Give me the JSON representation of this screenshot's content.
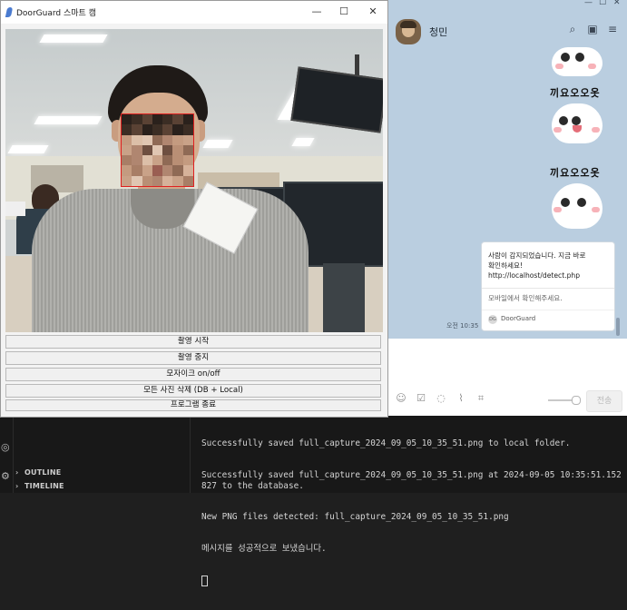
{
  "doorguard": {
    "title": "DoorGuard 스마트 캠",
    "buttons": [
      "촬영 시작",
      "촬영 중지",
      "모자이크 on/off",
      "모든 사진 삭제 (DB + Local)",
      "프로그램 종료"
    ]
  },
  "chat": {
    "contact_name": "청민",
    "sticker_text_1": "끼요오오옷",
    "sticker_text_2": "끼요오오옷",
    "message": {
      "line1": "사람이 감지되었습니다. 지금 바로",
      "line2": "확인하세요!",
      "url": "http://localhost/detect.php",
      "hint": "모바일에서 확인해주세요.",
      "source": "DoorGuard",
      "source_icon_label": "DG",
      "time": "오전 10:35"
    },
    "send_label": "전송"
  },
  "vscode": {
    "sections": [
      "OUTLINE",
      "TIMELINE"
    ],
    "terminal_lines": [
      "Successfully saved full_capture_2024_09_05_10_35_51.png to local folder.",
      "Successfully saved full_capture_2024_09_05_10_35_51.png at 2024-09-05 10:35:51.152827 to the database.",
      "New PNG files detected: full_capture_2024_09_05_10_35_51.png",
      "메시지를 성공적으로 보냈습니다."
    ]
  },
  "icons": {
    "doorguard_app": "feather-icon",
    "minimize": "minimize-icon",
    "maximize": "maximize-icon",
    "close": "close-icon",
    "chat_search": "search-icon",
    "chat_inbox": "inbox-icon",
    "chat_menu": "menu-icon",
    "emoji": "emoji-icon",
    "checkbox": "checkbox-icon",
    "bubble": "chat-bubble-icon",
    "attach": "paperclip-icon",
    "crop": "crop-icon"
  },
  "colors": {
    "chat_bg": "#bacee0",
    "mosaic_border": "#e02020",
    "terminal_bg": "#181818"
  }
}
